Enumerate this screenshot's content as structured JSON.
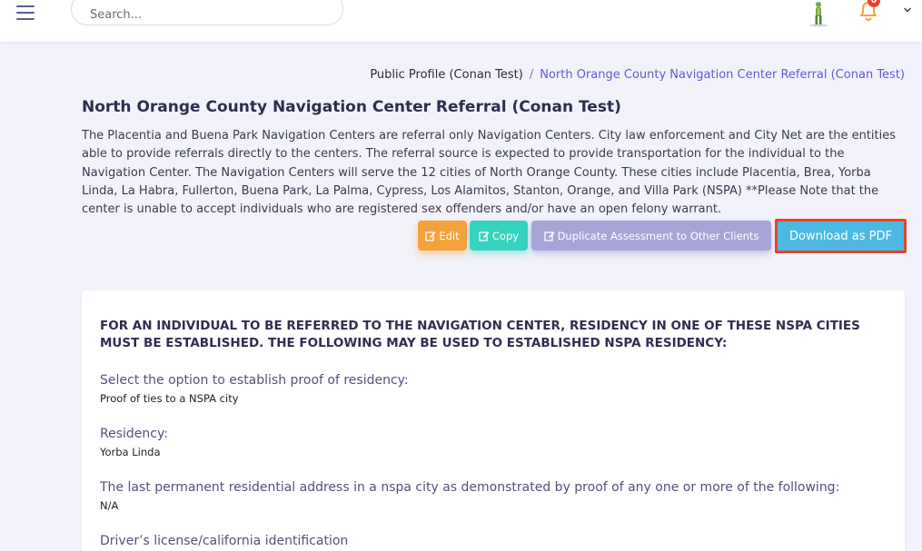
{
  "header": {
    "search_placeholder": "Search...",
    "notification_count": "0",
    "icons": {
      "menu": "hamburger-menu-icon",
      "avatar": "user-avatar-icon",
      "bell": "bell-icon",
      "caret": "chevron-down-icon"
    }
  },
  "breadcrumb": {
    "parent": "Public Profile (Conan Test)",
    "separator": "/",
    "current": "North Orange County Navigation Center Referral (Conan Test)"
  },
  "page": {
    "title": "North Orange County Navigation Center Referral (Conan Test)",
    "description": "The Placentia and Buena Park Navigation Centers are referral only Navigation Centers. City law enforcement and City Net are the entities able to provide referrals directly to the centers. The referral source is expected to provide transportation for the individual to the Navigation Center. The Navigation Centers will serve the 12 cities of North Orange County. These cities include Placentia, Brea, Yorba Linda, La Habra, Fullerton, Buena Park, La Palma, Cypress, Los Alamitos, Stanton, Orange, and Villa Park (NSPA) **Please Note that the center is unable to accept individuals who are registered sex offenders and/or have an open felony warrant."
  },
  "actions": {
    "edit": "Edit",
    "copy": "Copy",
    "duplicate": "Duplicate Assessment to Other Clients",
    "download_pdf": "Download as PDF"
  },
  "card": {
    "heading": "FOR AN INDIVIDUAL TO BE REFERRED TO THE NAVIGATION CENTER, RESIDENCY IN ONE OF THESE NSPA CITIES MUST BE ESTABLISHED. THE FOLLOWING MAY BE USED TO ESTABLISHED NSPA RESIDENCY:",
    "fields": [
      {
        "question": "Select the option to establish proof of residency:",
        "answer": "Proof of ties to a NSPA city"
      },
      {
        "question": "Residency:",
        "answer": "Yorba Linda"
      },
      {
        "question": "The last permanent residential address in a nspa city as demonstrated by proof of any one or more of the following:",
        "answer": "N/A"
      },
      {
        "question": "Driver’s license/california identification",
        "answer": ""
      }
    ]
  },
  "colors": {
    "page_bg": "#f2f2fa",
    "accent": "#6658d8",
    "edit": "#f5a23a",
    "copy": "#36d3bf",
    "duplicate": "#a7a4d8",
    "pdf": "#4db9e3",
    "highlight_border": "#e2462a",
    "badge": "#e8412c"
  }
}
